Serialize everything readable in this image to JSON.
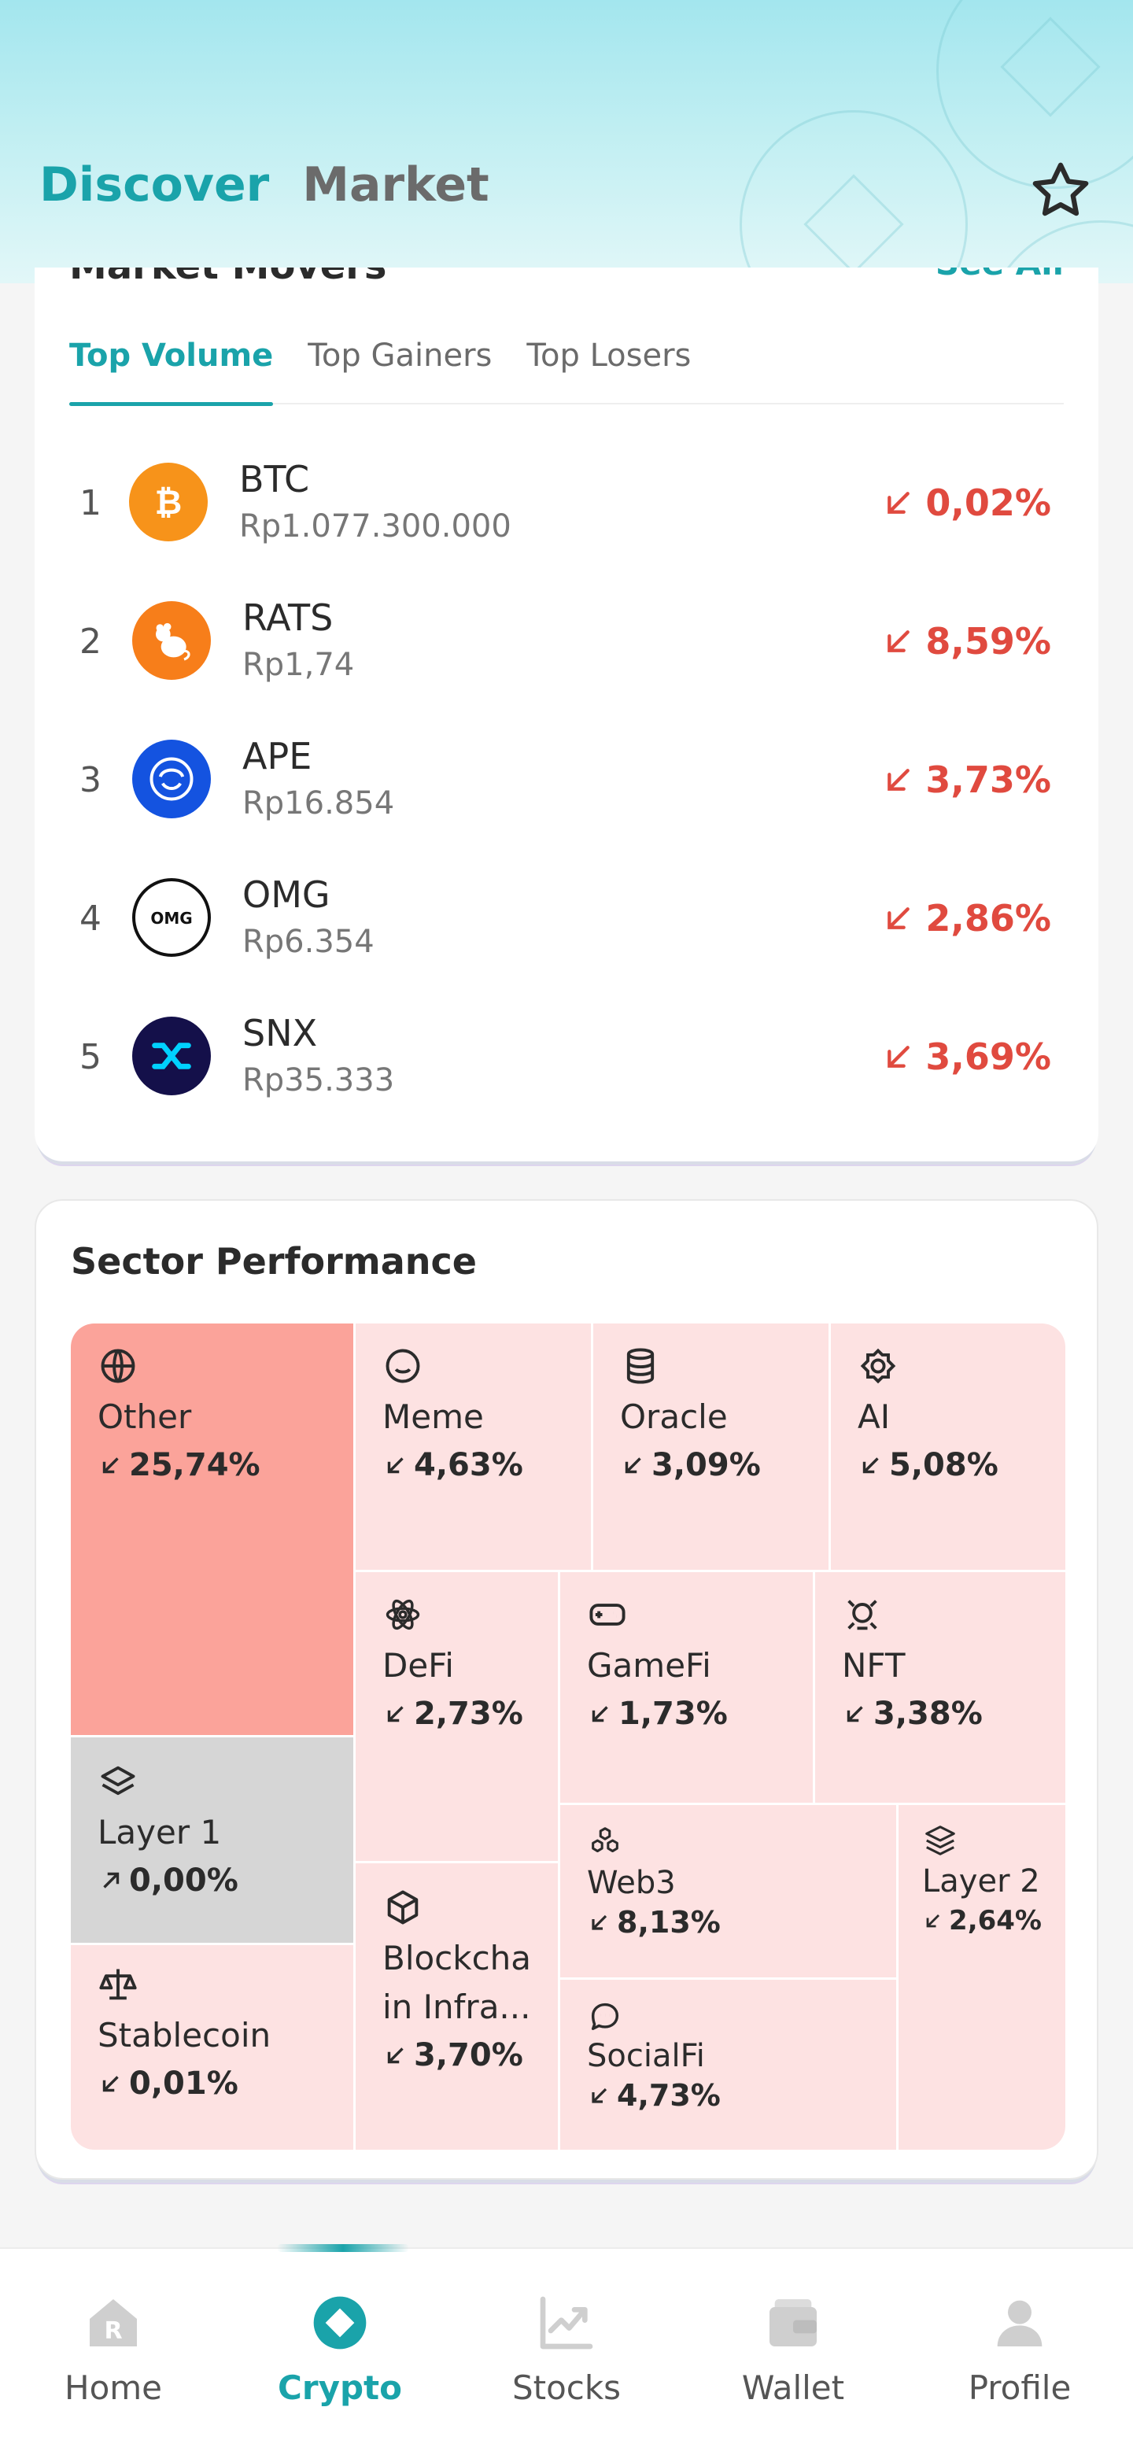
{
  "header": {
    "tabs": [
      {
        "label": "Discover",
        "active": true
      },
      {
        "label": "Market",
        "active": false
      }
    ],
    "accent_color": "#1aa3aa"
  },
  "market_movers": {
    "title": "Market Movers",
    "see_all": "See All",
    "tabs": [
      {
        "label": "Top Volume",
        "active": true
      },
      {
        "label": "Top Gainers",
        "active": false
      },
      {
        "label": "Top Losers",
        "active": false
      }
    ],
    "items": [
      {
        "rank": "1",
        "symbol": "BTC",
        "price": "Rp1.077.300.000",
        "change": "0,02%",
        "direction": "down",
        "icon": "btc-icon"
      },
      {
        "rank": "2",
        "symbol": "RATS",
        "price": "Rp1,74",
        "change": "8,59%",
        "direction": "down",
        "icon": "rats-icon"
      },
      {
        "rank": "3",
        "symbol": "APE",
        "price": "Rp16.854",
        "change": "3,73%",
        "direction": "down",
        "icon": "ape-icon"
      },
      {
        "rank": "4",
        "symbol": "OMG",
        "price": "Rp6.354",
        "change": "2,86%",
        "direction": "down",
        "icon": "omg-icon"
      },
      {
        "rank": "5",
        "symbol": "SNX",
        "price": "Rp35.333",
        "change": "3,69%",
        "direction": "down",
        "icon": "snx-icon"
      }
    ],
    "down_color": "#e04a3f"
  },
  "sector_performance": {
    "title": "Sector Performance",
    "sectors": [
      {
        "name": "Other",
        "change": "25,74%",
        "direction": "down",
        "icon": "globe-icon"
      },
      {
        "name": "Meme",
        "change": "4,63%",
        "direction": "down",
        "icon": "smile-icon"
      },
      {
        "name": "Oracle",
        "change": "3,09%",
        "direction": "down",
        "icon": "database-icon"
      },
      {
        "name": "AI",
        "change": "5,08%",
        "direction": "down",
        "icon": "ai-chip-icon"
      },
      {
        "name": "DeFi",
        "change": "2,73%",
        "direction": "down",
        "icon": "atom-icon"
      },
      {
        "name": "GameFi",
        "change": "1,73%",
        "direction": "down",
        "icon": "gamepad-icon"
      },
      {
        "name": "NFT",
        "change": "3,38%",
        "direction": "down",
        "icon": "nft-icon"
      },
      {
        "name": "Layer 1",
        "change": "0,00%",
        "direction": "up",
        "icon": "layers-icon"
      },
      {
        "name": "Web3",
        "change": "8,13%",
        "direction": "down",
        "icon": "cubes-icon"
      },
      {
        "name": "Layer 2",
        "change": "2,64%",
        "direction": "down",
        "icon": "layers-stack-icon"
      },
      {
        "name": "Blockchain Infra...",
        "change": "3,70%",
        "direction": "down",
        "icon": "hexagon-icon"
      },
      {
        "name": "SocialFi",
        "change": "4,73%",
        "direction": "down",
        "icon": "chat-icon"
      },
      {
        "name": "Stablecoin",
        "change": "0,01%",
        "direction": "down",
        "icon": "scale-icon"
      }
    ],
    "colors": {
      "strong_down": "#fba39a",
      "light_down": "#fde2e2",
      "neutral": "#d6d6d6"
    }
  },
  "bottom_nav": {
    "items": [
      {
        "label": "Home",
        "active": false,
        "icon": "home-icon"
      },
      {
        "label": "Crypto",
        "active": true,
        "icon": "crypto-icon"
      },
      {
        "label": "Stocks",
        "active": false,
        "icon": "chart-icon"
      },
      {
        "label": "Wallet",
        "active": false,
        "icon": "wallet-icon"
      },
      {
        "label": "Profile",
        "active": false,
        "icon": "profile-icon"
      }
    ]
  }
}
